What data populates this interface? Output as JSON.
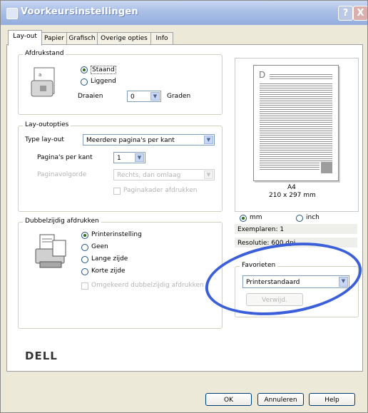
{
  "window": {
    "title": "Voorkeursinstellingen",
    "help_label": "?",
    "close_label": "X"
  },
  "tabs": [
    {
      "label": "Lay-out",
      "active": true
    },
    {
      "label": "Papier",
      "active": false
    },
    {
      "label": "Grafisch",
      "active": false
    },
    {
      "label": "Overige opties",
      "active": false
    },
    {
      "label": "Info",
      "active": false
    }
  ],
  "orientation": {
    "legend": "Afdrukstand",
    "portrait_label": "Staand",
    "landscape_label": "Liggend",
    "selected": "Staand",
    "rotate_label": "Draaien",
    "rotate_value": "0",
    "degrees_label": "Graden"
  },
  "layout_options": {
    "legend": "Lay-outopties",
    "type_label": "Type lay-out",
    "type_value": "Meerdere pagina's per kant",
    "pages_label": "Pagina's per kant",
    "pages_value": "1",
    "order_label": "Paginavolgorde",
    "order_value": "Rechts, dan omlaag",
    "border_label": "Paginakader afdrukken"
  },
  "duplex": {
    "legend": "Dubbelzijdig afdrukken",
    "options": [
      "Printerinstelling",
      "Geen",
      "Lange zijde",
      "Korte zijde"
    ],
    "selected": "Printerinstelling",
    "reverse_label": "Omgekeerd dubbelzijdig afdrukken"
  },
  "preview": {
    "page_letter": "D",
    "paper_name": "A4",
    "paper_size": "210 x 297 mm",
    "unit_mm": "mm",
    "unit_inch": "inch",
    "unit_selected": "mm",
    "copies_text": "Exemplaren: 1",
    "resolution_text": "Resolutie: 600 dpi"
  },
  "favorites": {
    "legend": "Favorieten",
    "value": "Printerstandaard",
    "delete_label": "Verwijd."
  },
  "brand": {
    "logo": "DELL"
  },
  "footer": {
    "ok_label": "OK",
    "cancel_label": "Annuleren",
    "help_label": "Help"
  },
  "colors": {
    "titlebar": "#93addd",
    "annotation_ellipse": "#3a5fd9"
  }
}
